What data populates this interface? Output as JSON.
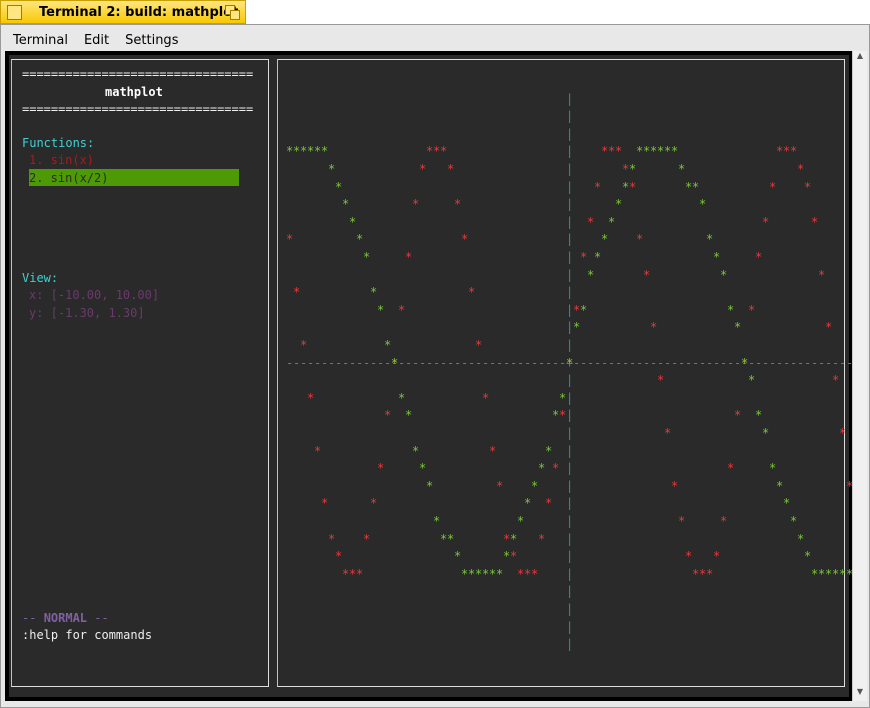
{
  "window": {
    "title": "Terminal 2: build: mathplot"
  },
  "menu": [
    "Terminal",
    "Edit",
    "Settings"
  ],
  "sidebar": {
    "rule": "================================",
    "title": "mathplot",
    "functions_label": "Functions:",
    "functions": [
      "1. sin(x)",
      "2. sin(x/2)"
    ],
    "selected_index": 1,
    "view_label": "View:",
    "x_range": "x: [-10.00, 10.00]",
    "y_range": "y: [-1.30, 1.30]",
    "mode_dash": "--",
    "mode": "NORMAL",
    "help": ":help for commands"
  },
  "colors": {
    "sin_x": "#e83a3a",
    "sin_x2": "#78c83a",
    "axis": "#1a9a9a",
    "cyan": "#40d0d0",
    "selected_bg": "#4e9a06"
  },
  "chart_data": {
    "type": "line",
    "series": [
      {
        "name": "sin(x)",
        "expr": "sin(x)",
        "color": "#e83a3a"
      },
      {
        "name": "sin(x/2)",
        "expr": "sin(x/2)",
        "color": "#78c83a"
      }
    ],
    "xlim": [
      -10,
      10
    ],
    "ylim": [
      -1.3,
      1.3
    ],
    "marker": "*"
  }
}
